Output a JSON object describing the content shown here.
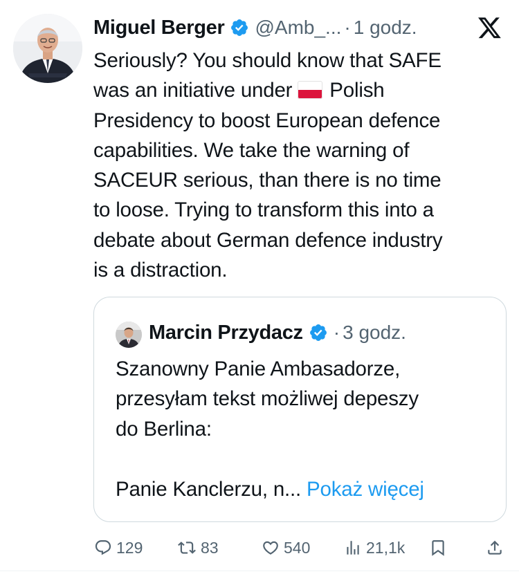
{
  "tweet": {
    "author_name": "Miguel Berger",
    "handle": "@Amb_...",
    "separator": "·",
    "time": "1 godz.",
    "text_lines": [
      "Seriously? You should know that SAFE",
      "was an initiative under",
      "Polish",
      "Presidency to boost European defence",
      "capabilities. We take the warning of",
      "SACEUR serious, than there is no time",
      "to loose. Trying to transform this into a",
      "debate about German defence industry",
      "is a distraction."
    ]
  },
  "quote": {
    "author_name": "Marcin Przydacz",
    "separator": "·",
    "time": "3 godz.",
    "text_lines": [
      "Szanowny Panie Ambasadorze,",
      "przesyłam tekst możliwej depeszy",
      "do Berlina:",
      "",
      "Panie Kanclerzu, n..."
    ],
    "show_more": "Pokaż więcej"
  },
  "actions": {
    "replies": "129",
    "reposts": "83",
    "likes": "540",
    "views": "21,1k"
  },
  "icons": {
    "verified": "verified-badge-icon",
    "x_logo": "x-logo-icon",
    "flag": "poland-flag-icon",
    "reply": "reply-icon",
    "repost": "repost-icon",
    "like": "heart-icon",
    "views": "views-icon",
    "bookmark": "bookmark-icon",
    "share": "share-icon"
  },
  "colors": {
    "text": "#0f1419",
    "secondary": "#536471",
    "link": "#1d9bf0",
    "verified": "#1d9bf0",
    "border": "#cfd9de"
  }
}
